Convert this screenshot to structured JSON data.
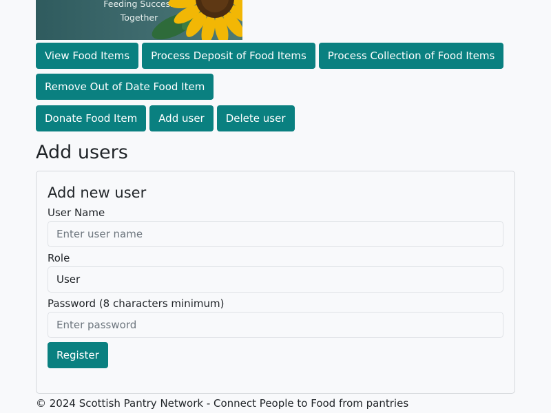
{
  "banner": {
    "line1": "Feeding Success",
    "line2": "Together"
  },
  "nav": {
    "view_food": "View Food Items",
    "process_deposit": "Process Deposit of Food Items",
    "process_collection": "Process Collection of Food Items",
    "remove_expired": "Remove Out of Date Food Item",
    "donate": "Donate Food Item",
    "add_user": "Add user",
    "delete_user": "Delete user"
  },
  "page": {
    "title": "Add users"
  },
  "form": {
    "title": "Add new user",
    "username_label": "User Name",
    "username_placeholder": "Enter user name",
    "role_label": "Role",
    "role_value": "User",
    "password_label": "Password (8 characters minimum)",
    "password_placeholder": "Enter password",
    "register_label": "Register"
  },
  "footer": {
    "text": "© 2024 Scottish Pantry Network - Connect People to Food from pantries"
  },
  "colors": {
    "button": "#0a8080",
    "background": "#f8f9fb"
  }
}
